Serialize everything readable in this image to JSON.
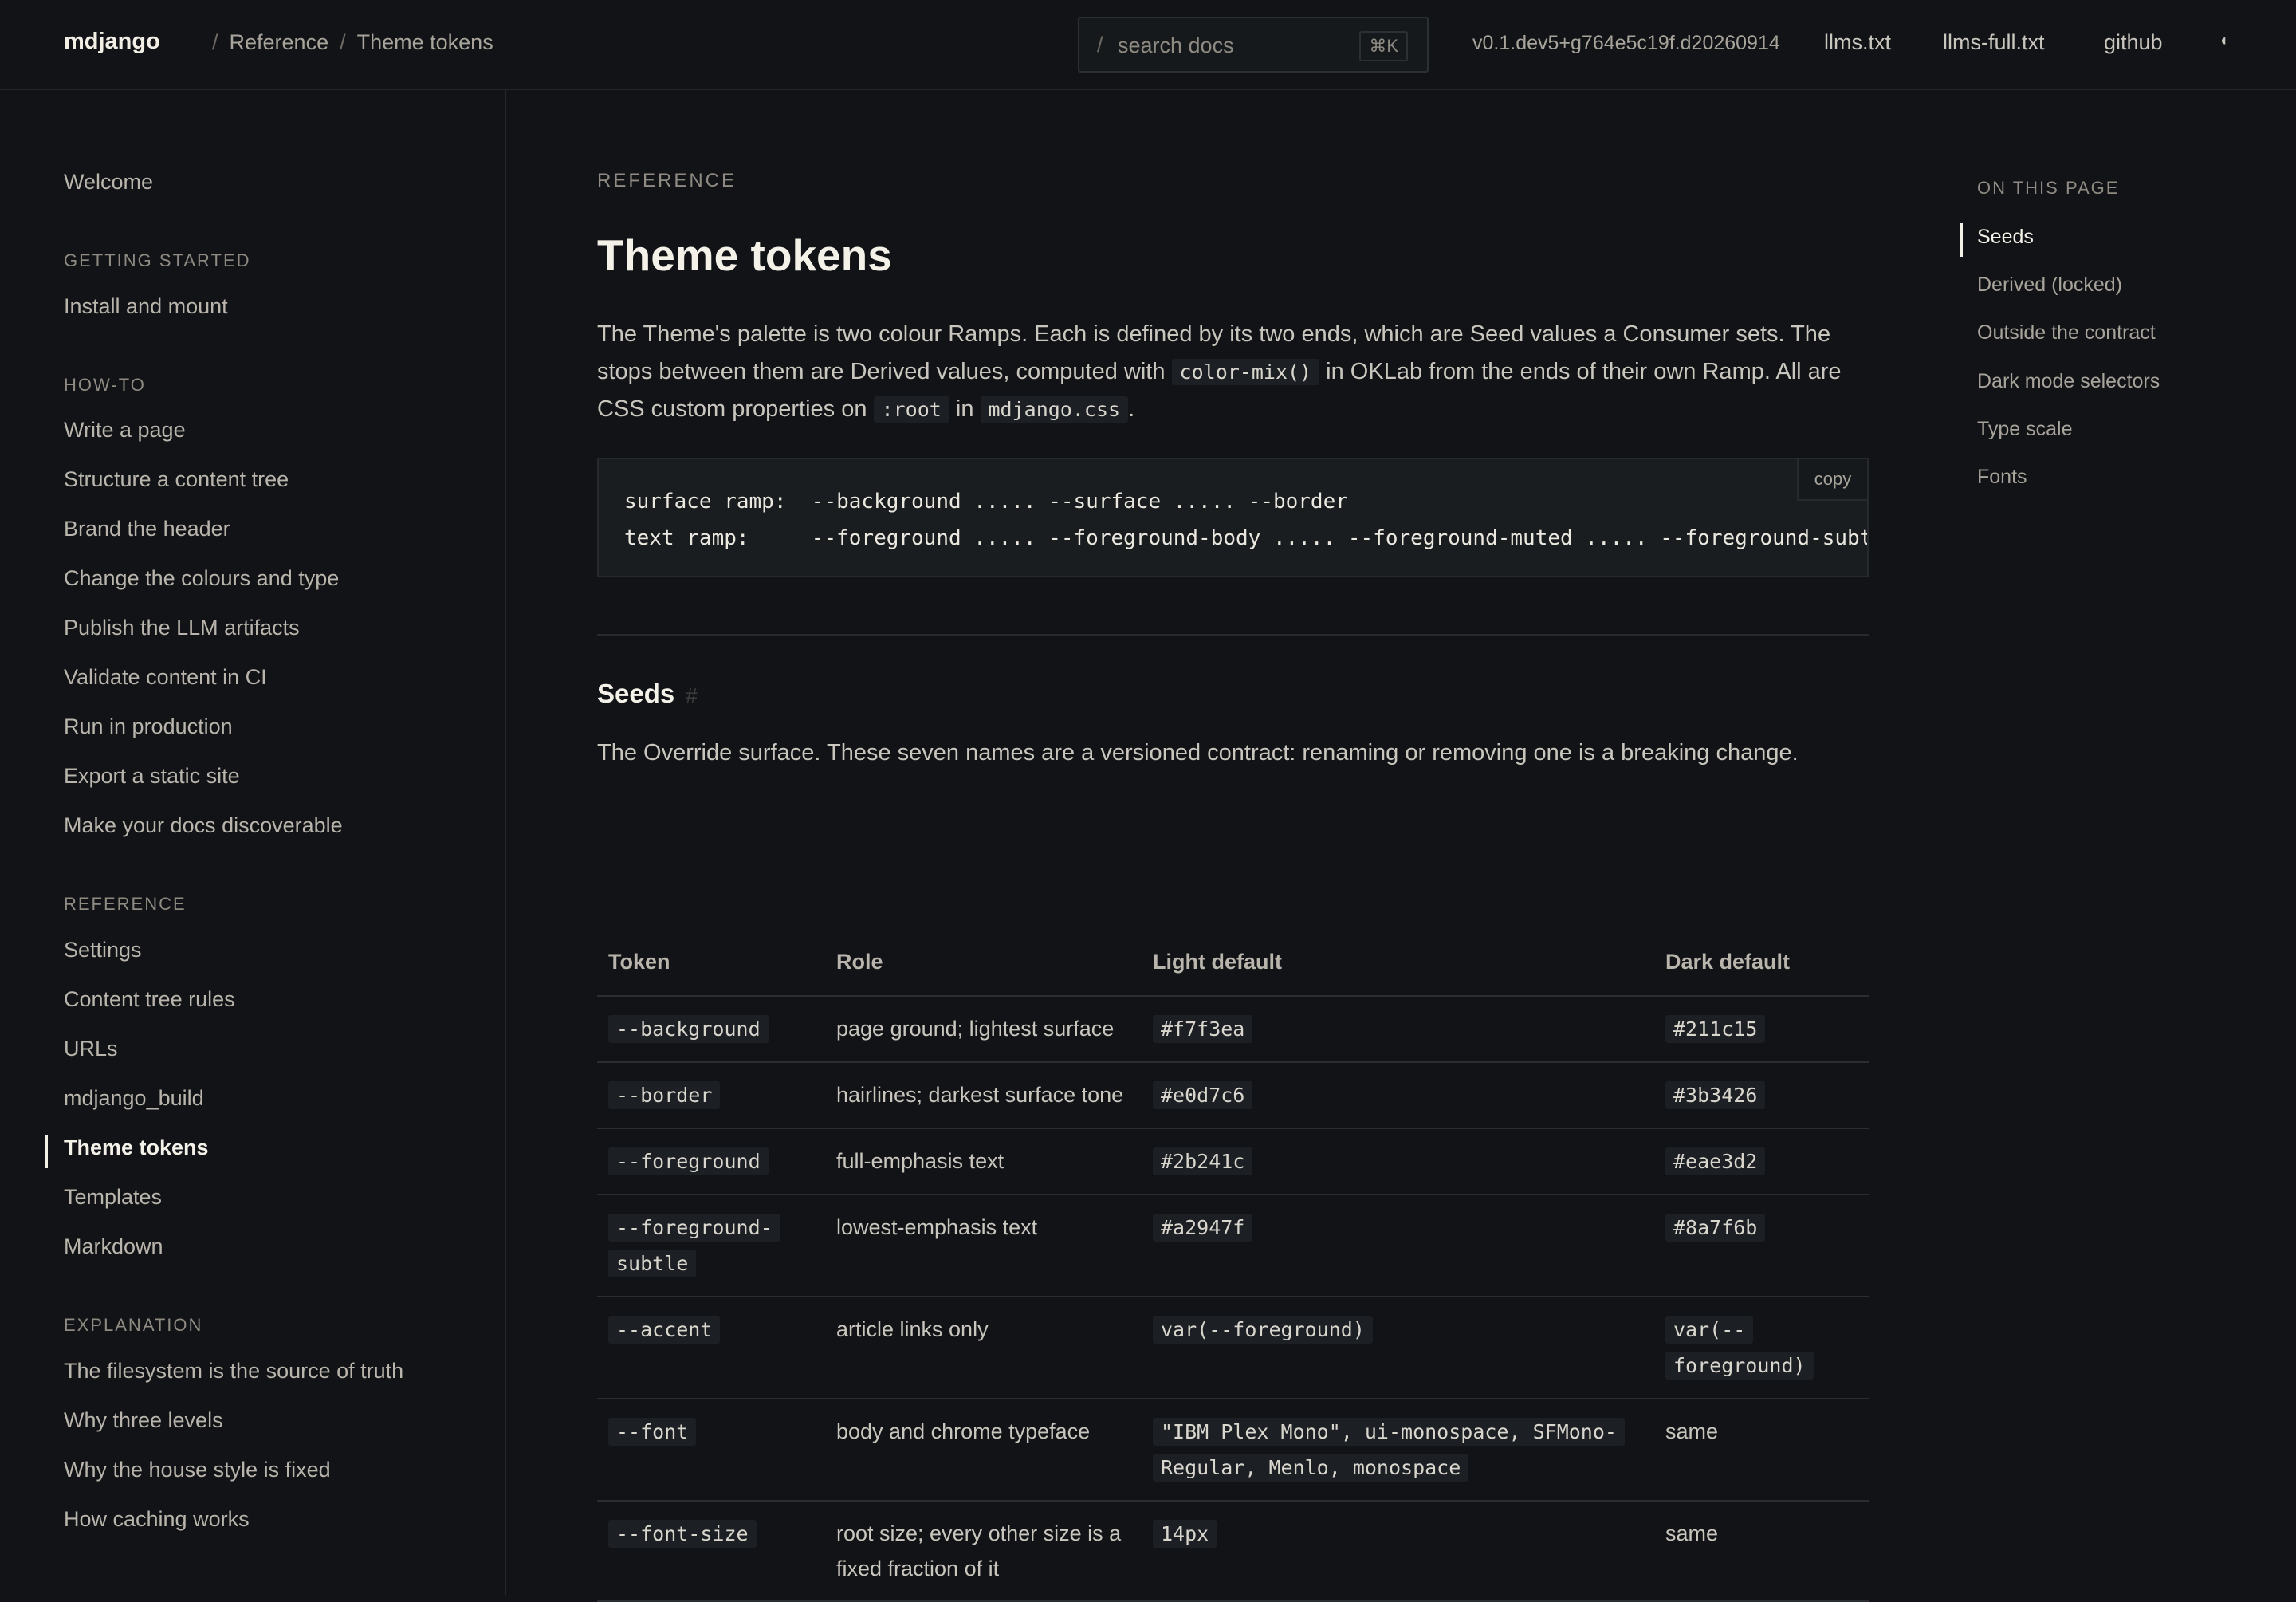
{
  "header": {
    "brand": "mdjango",
    "breadcrumb": [
      "Reference",
      "Theme tokens"
    ],
    "search": {
      "slash": "/",
      "placeholder": "search docs",
      "shortcut": "⌘K"
    },
    "version": "v0.1.dev5+g764e5c19f.d20260914",
    "links": [
      "llms.txt",
      "llms-full.txt",
      "github"
    ],
    "mode_toggle": "◖"
  },
  "sidebar": {
    "top": "Welcome",
    "sections": [
      {
        "title": "GETTING STARTED",
        "items": [
          "Install and mount"
        ]
      },
      {
        "title": "HOW-TO",
        "items": [
          "Write a page",
          "Structure a content tree",
          "Brand the header",
          "Change the colours and type",
          "Publish the LLM artifacts",
          "Validate content in CI",
          "Run in production",
          "Export a static site",
          "Make your docs discoverable"
        ]
      },
      {
        "title": "REFERENCE",
        "items": [
          "Settings",
          "Content tree rules",
          "URLs",
          "mdjango_build",
          "Theme tokens",
          "Templates",
          "Markdown"
        ]
      },
      {
        "title": "EXPLANATION",
        "items": [
          "The filesystem is the source of truth",
          "Why three levels",
          "Why the house style is fixed",
          "How caching works"
        ]
      }
    ],
    "active": "Theme tokens"
  },
  "main": {
    "eyebrow": "REFERENCE",
    "title": "Theme tokens",
    "intro": {
      "p1": "The Theme's palette is two colour Ramps. Each is defined by its two ends, which are Seed values a Consumer sets. The stops between them are Derived values, computed with ",
      "code1": "color-mix()",
      "p2": " in OKLab from the ends of their own Ramp. All are CSS custom properties on ",
      "code2": ":root",
      "p3": " in ",
      "code3": "mdjango.css",
      "p4": "."
    },
    "codeblock": {
      "line1": "surface ramp:  --background ..... --surface ..... --border",
      "line2": "text ramp:     --foreground ..... --foreground-body ..... --foreground-muted ..... --foreground-subtle",
      "copy_label": "copy"
    },
    "seeds": {
      "heading": "Seeds",
      "anchor": "#",
      "text": "The Override surface. These seven names are a versioned contract: renaming or removing one is a breaking change.",
      "columns": [
        "Token",
        "Role",
        "Light default",
        "Dark default"
      ],
      "rows": [
        {
          "token": "--background",
          "role": "page ground; lightest surface",
          "light": "#f7f3ea",
          "dark": "#211c15"
        },
        {
          "token": "--border",
          "role": "hairlines; darkest surface tone",
          "light": "#e0d7c6",
          "dark": "#3b3426"
        },
        {
          "token": "--foreground",
          "role": "full-emphasis text",
          "light": "#2b241c",
          "dark": "#eae3d2"
        },
        {
          "token": "--foreground-subtle",
          "role": "lowest-emphasis text",
          "light": "#a2947f",
          "dark": "#8a7f6b"
        },
        {
          "token": "--accent",
          "role": "article links only",
          "light": "var(--foreground)",
          "dark": "var(--foreground)"
        },
        {
          "token": "--font",
          "role": "body and chrome typeface",
          "light": "\"IBM Plex Mono\", ui-monospace, SFMono-Regular, Menlo, monospace",
          "dark": "same"
        },
        {
          "token": "--font-size",
          "role": "root size; every other size is a fixed fraction of it",
          "light": "14px",
          "dark": "same"
        }
      ]
    }
  },
  "toc": {
    "title": "ON THIS PAGE",
    "items": [
      "Seeds",
      "Derived (locked)",
      "Outside the contract",
      "Dark mode selectors",
      "Type scale",
      "Fonts"
    ],
    "active": "Seeds"
  }
}
